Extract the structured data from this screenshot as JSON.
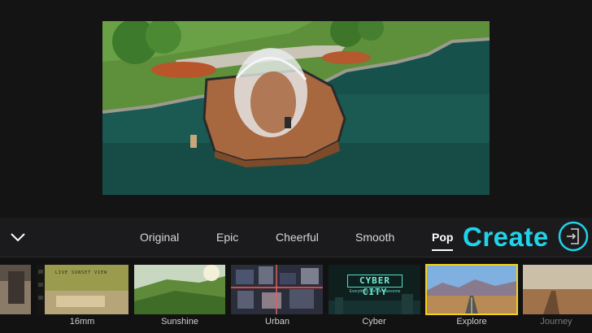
{
  "toolbar": {
    "tabs": [
      {
        "label": "Original"
      },
      {
        "label": "Epic"
      },
      {
        "label": "Cheerful"
      },
      {
        "label": "Smooth"
      },
      {
        "label": "Pop",
        "active": true
      }
    ],
    "create_label": "Create"
  },
  "thumbnails": [
    {
      "label": ""
    },
    {
      "label": "16mm",
      "overlay_text": "LIVE SUNSET VIEW"
    },
    {
      "label": "Sunshine"
    },
    {
      "label": "Urban"
    },
    {
      "label": "Cyber",
      "overlay_title": "CYBER CITY",
      "overlay_sub": "Everything can be awesome"
    },
    {
      "label": "Explore",
      "selected": true
    },
    {
      "label": "Journey"
    }
  ],
  "icons": {
    "collapse": "chevron-down-icon",
    "export": "export-arrow-icon"
  },
  "colors": {
    "accent": "#1fd3ea",
    "selected_outline": "#f2d21a",
    "background": "#121212"
  }
}
